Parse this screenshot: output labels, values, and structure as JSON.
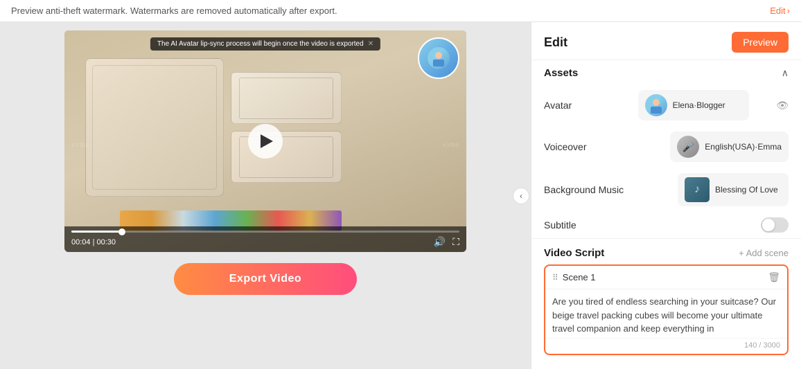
{
  "topbar": {
    "watermark_notice": "Preview anti-theft watermark. Watermarks are removed automatically after export.",
    "edit_label": "Edit",
    "edit_arrow": "›"
  },
  "video": {
    "current_time": "00:04",
    "total_time": "00:30",
    "progress_pct": 13,
    "notification": "The AI Avatar lip-sync process will begin once the video is exported",
    "play_label": "play"
  },
  "export": {
    "button_label": "Export Video"
  },
  "right_panel": {
    "title": "Edit",
    "preview_button": "Preview",
    "assets_section": "Assets",
    "avatar_label": "Avatar",
    "avatar_name": "Elena·Blogger",
    "voiceover_label": "Voiceover",
    "voiceover_name": "English(USA)·Emma",
    "background_music_label": "Background Music",
    "background_music_name": "Blessing Of Love",
    "subtitle_label": "Subtitle",
    "video_script_title": "Video Script",
    "add_scene_label": "+ Add scene",
    "scene_title": "Scene 1",
    "scene_text": "Are you tired of endless searching in your suitcase? Our beige travel packing cubes will become your ultimate travel companion and keep everything in",
    "scene_char_count": "140 / 3000",
    "collapse_arrow": "‹"
  },
  "colors": {
    "accent": "#ff6b35",
    "preview_btn_bg": "#ff6b35",
    "export_gradient_start": "#ff8c42",
    "export_gradient_end": "#ff4d7d",
    "scene_border": "#ff6b35"
  }
}
